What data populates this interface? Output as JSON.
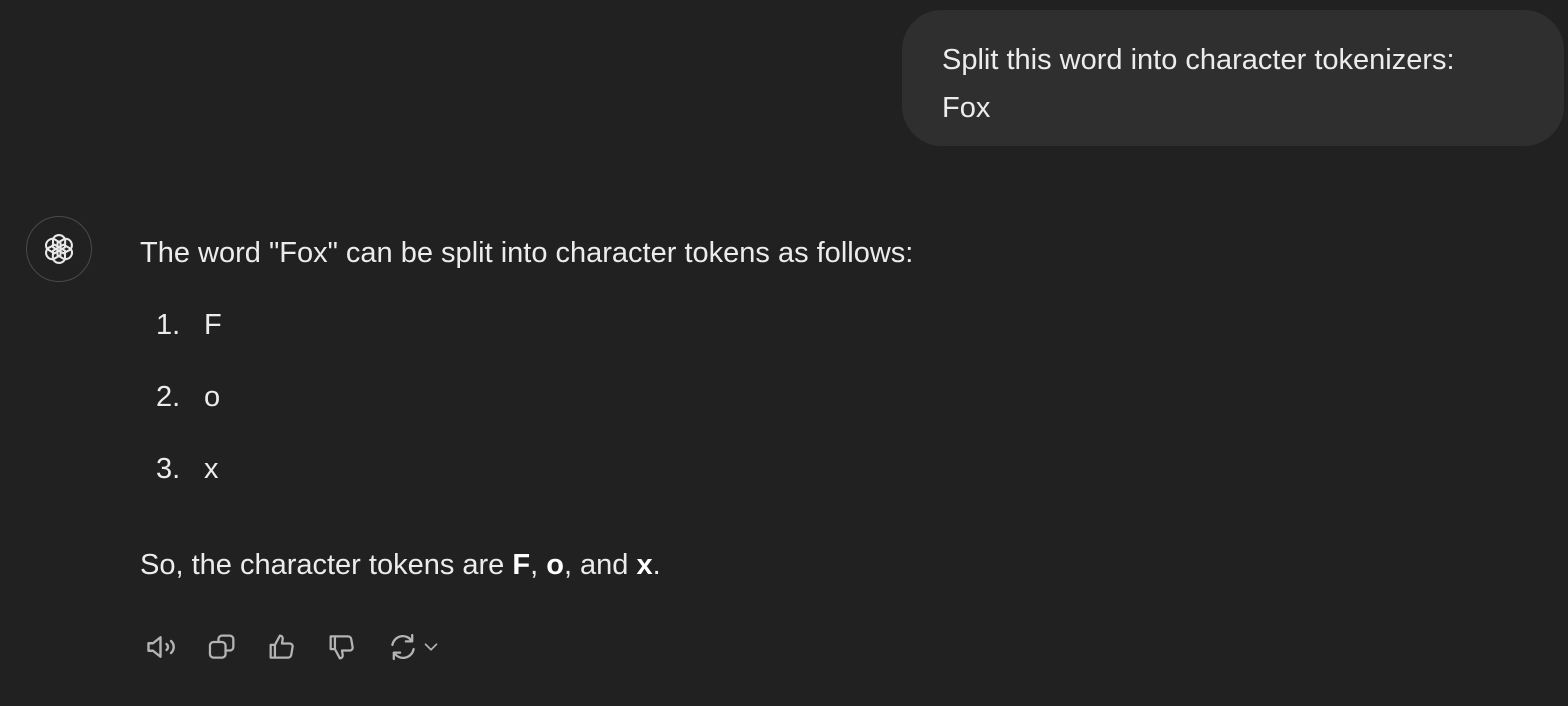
{
  "user_message": {
    "line1": "Split this word into character tokenizers:",
    "line2": "Fox"
  },
  "assistant": {
    "avatar_icon": "openai-logo-icon",
    "intro": "The word \"Fox\" can be split into character tokens as follows:",
    "tokens": [
      {
        "number": "1.",
        "value": "F"
      },
      {
        "number": "2.",
        "value": "o"
      },
      {
        "number": "3.",
        "value": "x"
      }
    ],
    "summary": {
      "prefix": "So, the character tokens are ",
      "t1": "F",
      "sep1": ", ",
      "t2": "o",
      "sep2": ", and ",
      "t3": "x",
      "suffix": "."
    }
  },
  "actions": {
    "icons": [
      "speaker-icon",
      "copy-icon",
      "thumbs-up-icon",
      "thumbs-down-icon",
      "regenerate-icon",
      "chevron-down-icon"
    ]
  },
  "colors": {
    "background": "#212121",
    "bubble": "#2f2f2f",
    "text": "#ececec",
    "icon": "#b4b4b4"
  }
}
